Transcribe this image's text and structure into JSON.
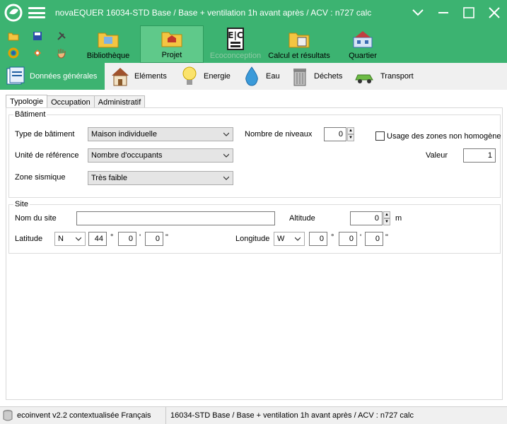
{
  "window": {
    "title": "novaEQUER   16034-STD Base / Base + ventilation 1h avant après / ACV : n727 calc",
    "logo_icon": "leaf-logo-icon",
    "menu_icon": "hamburger-menu-icon",
    "controls": [
      "chevron-down-icon",
      "minimize-icon",
      "maximize-icon",
      "close-icon"
    ]
  },
  "ribbon": {
    "quick_actions": [
      "open-folder-icon",
      "save-icon",
      "tools-icon",
      "help-icon",
      "refresh-icon",
      "hand-icon"
    ],
    "buttons": [
      {
        "label": "Bibliothèque",
        "icon": "library-folder-icon",
        "active": false,
        "disabled": false
      },
      {
        "label": "Projet",
        "icon": "project-folder-icon",
        "active": true,
        "disabled": false
      },
      {
        "label": "Ecoconception",
        "icon": "eco-design-icon",
        "active": false,
        "disabled": true
      },
      {
        "label": "Calcul et résultats",
        "icon": "calculator-folder-icon",
        "active": false,
        "disabled": false
      },
      {
        "label": "Quartier",
        "icon": "district-icon",
        "active": false,
        "disabled": false
      }
    ]
  },
  "subtabs": [
    {
      "label": "Données générales",
      "icon": "general-data-icon",
      "active": true
    },
    {
      "label": "Eléments",
      "icon": "house-icon",
      "active": false
    },
    {
      "label": "Energie",
      "icon": "lightbulb-icon",
      "active": false
    },
    {
      "label": "Eau",
      "icon": "water-drop-icon",
      "active": false
    },
    {
      "label": "Déchets",
      "icon": "trash-bin-icon",
      "active": false
    },
    {
      "label": "Transport",
      "icon": "car-icon",
      "active": false
    }
  ],
  "tabs": [
    {
      "label": "Typologie",
      "active": true
    },
    {
      "label": "Occupation",
      "active": false
    },
    {
      "label": "Administratif",
      "active": false
    }
  ],
  "batiment": {
    "title": "Bâtiment",
    "type_label": "Type de bâtiment",
    "type_value": "Maison individuelle",
    "unite_label": "Unité de référence",
    "unite_value": "Nombre d'occupants",
    "zone_label": "Zone sismique",
    "zone_value": "Très faible",
    "niveaux_label": "Nombre de niveaux",
    "niveaux_value": "0",
    "usage_label": "Usage des zones non homogène",
    "valeur_label": "Valeur",
    "valeur_value": "1"
  },
  "site": {
    "title": "Site",
    "nom_label": "Nom du site",
    "nom_value": "",
    "altitude_label": "Altitude",
    "altitude_value": "0",
    "altitude_unit": "m",
    "latitude_label": "Latitude",
    "lat_dir": "N",
    "lat_deg": "44",
    "lat_min": "0",
    "lat_sec": "0",
    "longitude_label": "Longitude",
    "lon_dir": "W",
    "lon_deg": "0",
    "lon_min": "0",
    "lon_sec": "0",
    "deg_sym": "°",
    "min_sym": "'",
    "sec_sym": "\""
  },
  "status": {
    "database": "ecoinvent v2.2 contextualisée Français",
    "project": "16034-STD Base / Base + ventilation 1h avant après / ACV : n727 calc",
    "db_icon": "database-icon"
  }
}
